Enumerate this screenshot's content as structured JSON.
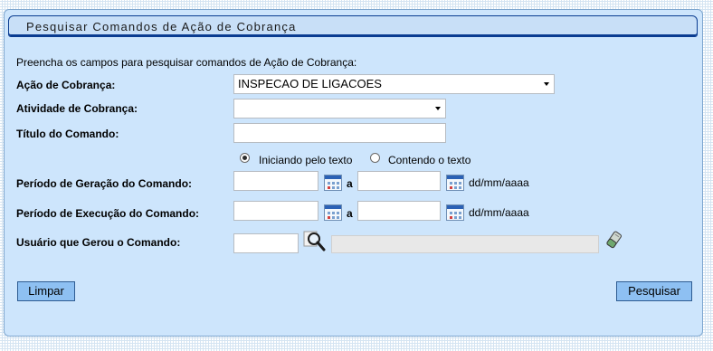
{
  "title": "Pesquisar Comandos de Ação de Cobrança",
  "instructions": "Preencha os campos para pesquisar comandos de Ação de Cobrança:",
  "fields": {
    "acao_label": "Ação de Cobrança:",
    "acao_value": "INSPECAO DE LIGACOES",
    "atividade_label": "Atividade de Cobrança:",
    "atividade_value": "",
    "titulo_label": "Título do Comando:",
    "titulo_value": "",
    "radio_iniciando": "Iniciando pelo texto",
    "radio_contendo": "Contendo o texto",
    "periodo_geracao_label": "Período de Geração do Comando:",
    "periodo_execucao_label": "Período de Execução do Comando:",
    "separator_a": "a",
    "date_format": "dd/mm/aaaa",
    "usuario_label": "Usuário que Gerou o Comando:",
    "usuario_value": "",
    "usuario_nome": ""
  },
  "buttons": {
    "limpar": "Limpar",
    "pesquisar": "Pesquisar"
  },
  "icons": {
    "calendar": "calendar-icon",
    "search": "magnifier-icon",
    "clear": "eraser-icon"
  }
}
